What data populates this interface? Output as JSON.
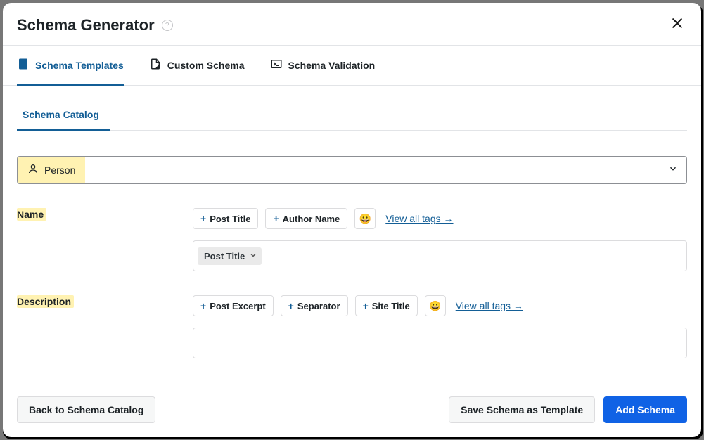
{
  "header": {
    "title": "Schema Generator"
  },
  "tabs": {
    "templates": "Schema Templates",
    "custom": "Custom Schema",
    "validation": "Schema Validation"
  },
  "subtab": {
    "catalog": "Schema Catalog"
  },
  "select": {
    "value": "Person"
  },
  "fields": {
    "name": {
      "label": "Name",
      "tags": {
        "post_title": "Post Title",
        "author_name": "Author Name"
      },
      "view_all": "View all tags →",
      "token": "Post Title"
    },
    "description": {
      "label": "Description",
      "tags": {
        "post_excerpt": "Post Excerpt",
        "separator": "Separator",
        "site_title": "Site Title"
      },
      "view_all": "View all tags →"
    }
  },
  "footer": {
    "back": "Back to Schema Catalog",
    "save_template": "Save Schema as Template",
    "add_schema": "Add Schema"
  }
}
